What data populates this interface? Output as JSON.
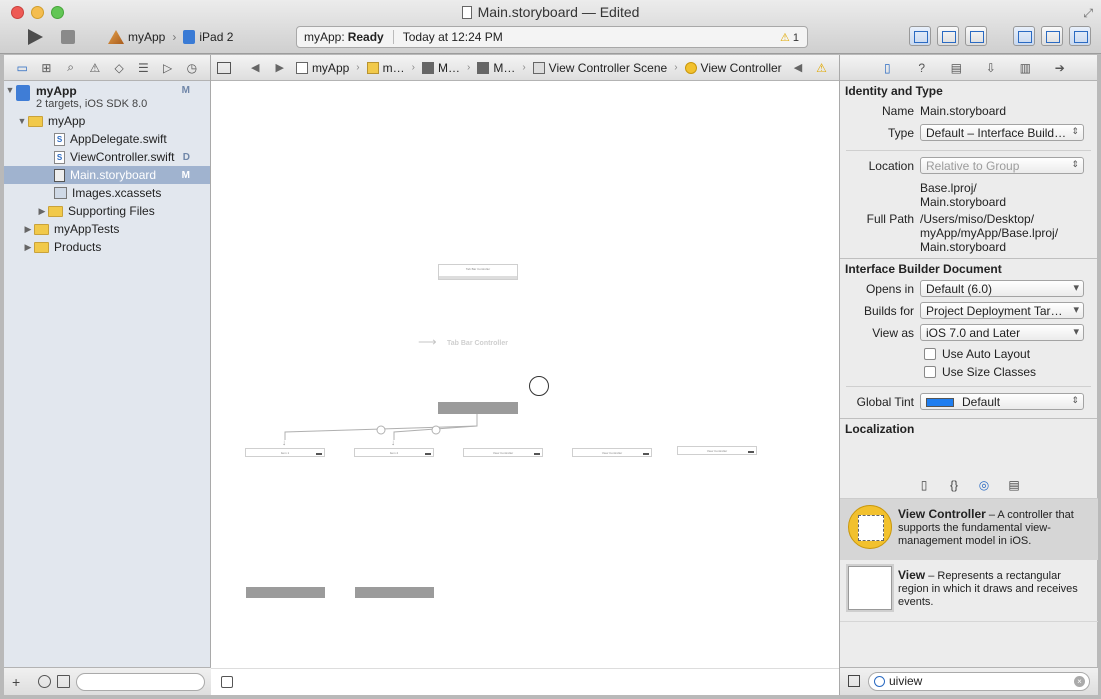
{
  "window": {
    "title": "Main.storyboard — Edited",
    "scheme_app": "myApp",
    "scheme_device": "iPad 2",
    "activity_app": "myApp:",
    "activity_status": "Ready",
    "activity_time": "Today at 12:24 PM",
    "warning_count": "1"
  },
  "navigator": {
    "project_name": "myApp",
    "project_sub": "2 targets, iOS SDK 8.0",
    "project_badge": "M",
    "items": [
      {
        "label": "myApp",
        "badge": ""
      },
      {
        "label": "AppDelegate.swift",
        "badge": ""
      },
      {
        "label": "ViewController.swift",
        "badge": "D"
      },
      {
        "label": "Main.storyboard",
        "badge": "M"
      },
      {
        "label": "Images.xcassets",
        "badge": ""
      },
      {
        "label": "Supporting Files",
        "badge": ""
      },
      {
        "label": "myAppTests",
        "badge": ""
      },
      {
        "label": "Products",
        "badge": ""
      }
    ]
  },
  "jumpbar": {
    "crumbs": [
      "myApp",
      "m…",
      "M…",
      "M…",
      "View Controller Scene",
      "View Controller"
    ]
  },
  "canvas": {
    "tab_bar_label": "Tab Bar Controller",
    "entry_label": "Tab Bar Controller",
    "item1": "Item 1",
    "item2": "Item 2",
    "vc_label": "View Controller"
  },
  "inspector": {
    "identity_title": "Identity and Type",
    "name_label": "Name",
    "name_value": "Main.storyboard",
    "type_label": "Type",
    "type_value": "Default – Interface Build…",
    "location_label": "Location",
    "location_value": "Relative to Group",
    "location_path1": "Base.lproj/",
    "location_path2": "Main.storyboard",
    "fullpath_label": "Full Path",
    "fullpath_1": "/Users/miso/Desktop/",
    "fullpath_2": "myApp/myApp/Base.lproj/",
    "fullpath_3": "Main.storyboard",
    "ib_title": "Interface Builder Document",
    "opens_label": "Opens in",
    "opens_value": "Default (6.0)",
    "builds_label": "Builds for",
    "builds_value": "Project Deployment Tar…",
    "viewas_label": "View as",
    "viewas_value": "iOS 7.0 and Later",
    "auto_layout": "Use Auto Layout",
    "size_classes": "Use Size Classes",
    "tint_label": "Global Tint",
    "tint_value": "Default",
    "tint_color": "#1f7ef0",
    "localization_title": "Localization"
  },
  "library": {
    "vc_title": "View Controller",
    "vc_desc": " – A controller that supports the fundamental view-management model in iOS.",
    "view_title": "View",
    "view_desc": " – Represents a rectangular region in which it draws and receives events.",
    "search_value": "uiview"
  }
}
